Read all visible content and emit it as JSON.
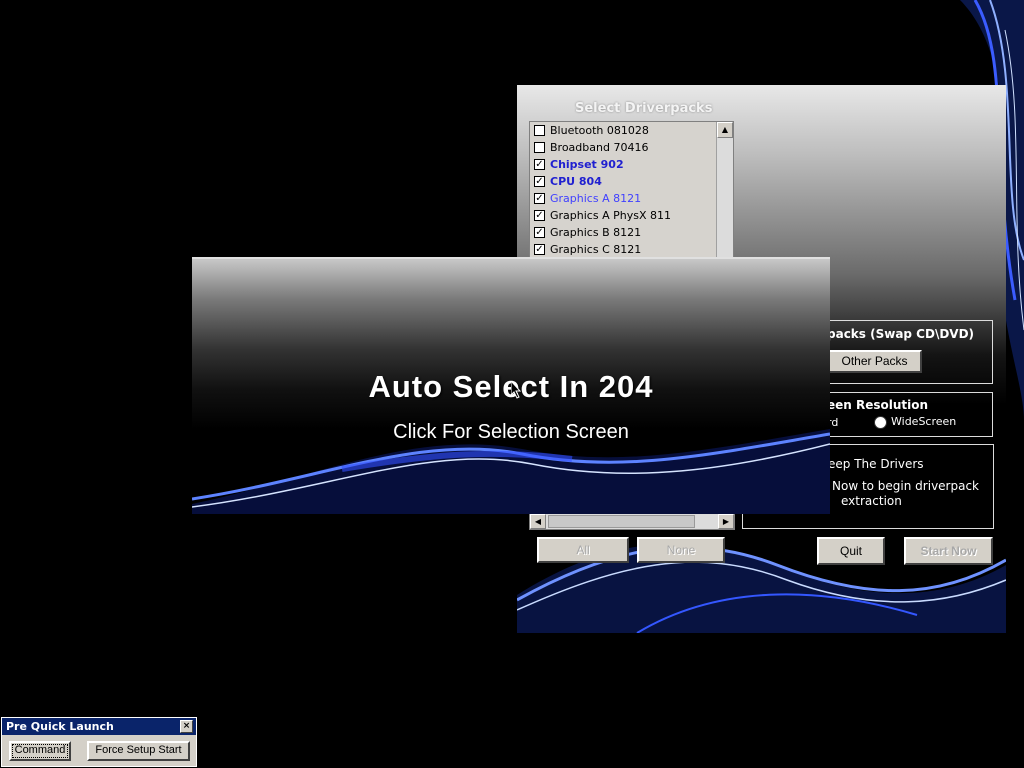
{
  "driverpack_window": {
    "title": "Select Driverpacks",
    "packs": [
      {
        "label": "Bluetooth 081028",
        "checked": false,
        "style": "normal"
      },
      {
        "label": "Broadband 70416",
        "checked": false,
        "style": "normal"
      },
      {
        "label": "Chipset 902",
        "checked": true,
        "style": "bold"
      },
      {
        "label": "CPU 804",
        "checked": true,
        "style": "bold"
      },
      {
        "label": "Graphics A 8121",
        "checked": true,
        "style": "blue"
      },
      {
        "label": "Graphics A PhysX 811",
        "checked": true,
        "style": "normal"
      },
      {
        "label": "Graphics B 8121",
        "checked": true,
        "style": "normal"
      },
      {
        "label": "Graphics C 8121",
        "checked": true,
        "style": "normal"
      }
    ],
    "other_packs_title": "packs (Swap CD\\DVD)",
    "other_packs_button": "Other Packs",
    "resolution_title": "een Resolution",
    "resolution_standard_partial": "rd",
    "resolution_widescreen": "WideScreen",
    "keep_drivers_title": "eep The Drivers",
    "keep_drivers_text_1": "Now to begin driverpack",
    "keep_drivers_text_2": "extraction",
    "all_button": "All",
    "none_button": "None",
    "quit_button": "Quit",
    "start_button": "Start Now"
  },
  "splash": {
    "title": "Auto Select In 204",
    "subtitle": "Click For Selection Screen"
  },
  "quick_launch": {
    "title": "Pre Quick Launch",
    "command_button": "Command",
    "force_button": "Force Setup Start"
  },
  "colors": {
    "accent_bold": "#2020d0",
    "accent_link": "#4040ff",
    "titlebar": "#0a246a"
  }
}
